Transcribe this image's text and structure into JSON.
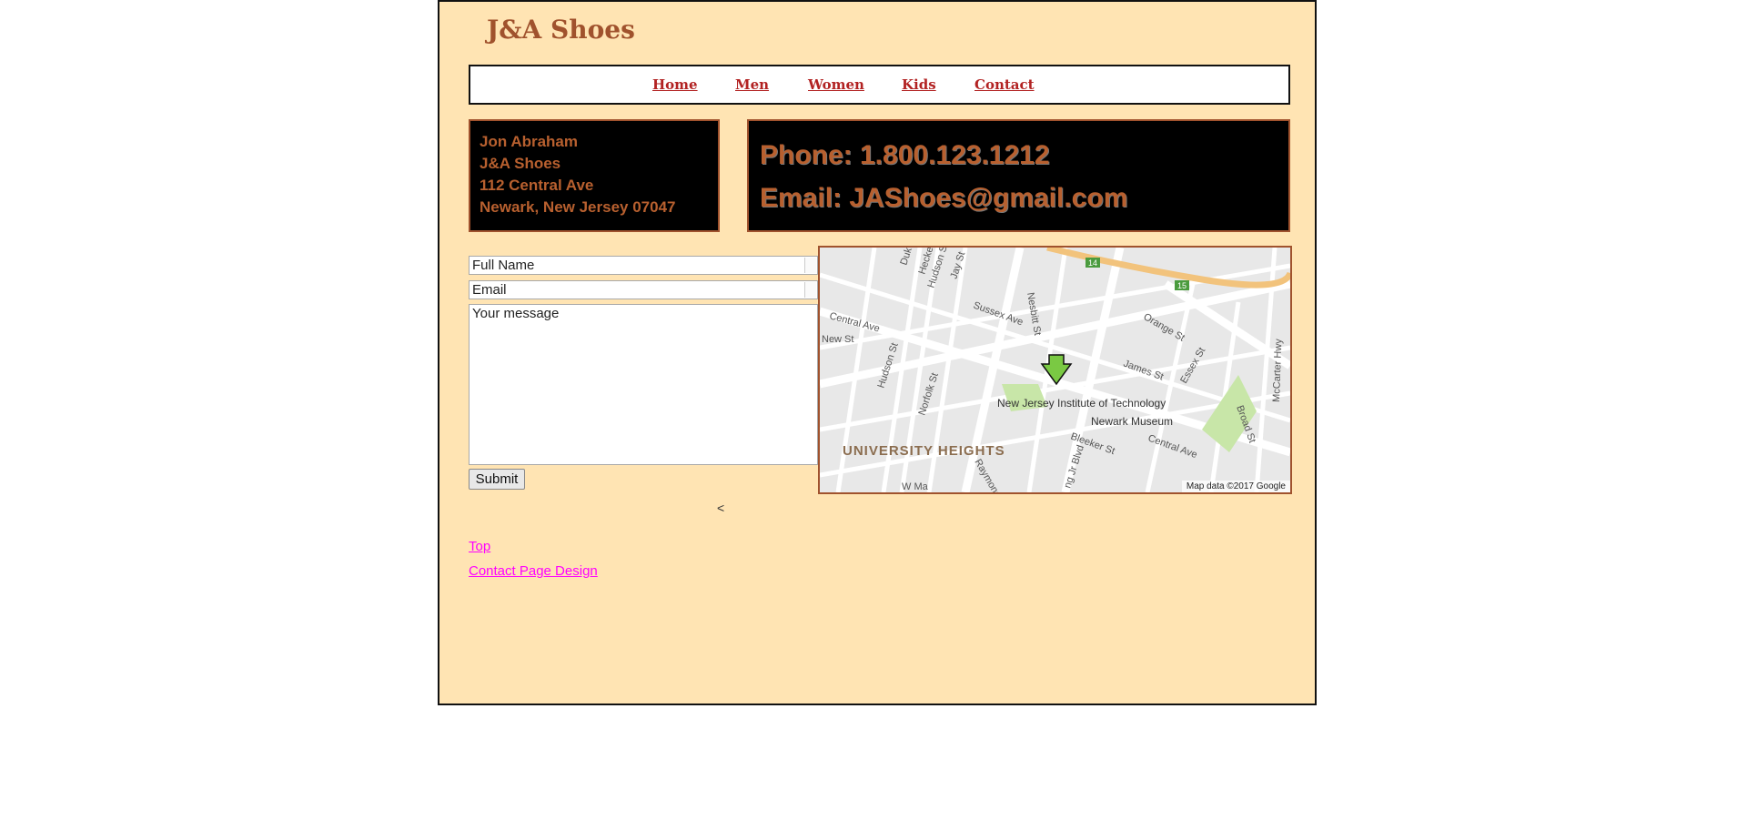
{
  "site": {
    "title": "J&A Shoes"
  },
  "nav": {
    "items": [
      "Home",
      "Men",
      "Women",
      "Kids",
      "Contact"
    ]
  },
  "address": {
    "name": "Jon Abraham",
    "company": "J&A Shoes",
    "street": "112 Central Ave",
    "city": "Newark, New Jersey 07047"
  },
  "contact": {
    "phone": "Phone: 1.800.123.1212",
    "email": "Email: JAShoes@gmail.com"
  },
  "form": {
    "name_placeholder": "Full Name",
    "email_placeholder": "Email",
    "message_placeholder": "Your message",
    "submit_label": "Submit"
  },
  "map": {
    "credit": "Map data ©2017 Google",
    "area_label": "UNIVERSITY HEIGHTS",
    "poi": [
      "New Jersey Institute of Technology",
      "Newark Museum"
    ],
    "streets": [
      "Central Ave",
      "New St",
      "Hudson St",
      "Norfolk St",
      "Sussex Ave",
      "Nesbitt St",
      "Orange St",
      "James St",
      "Essex St",
      "Broad St",
      "McCarter Hwy",
      "Bleeker St",
      "Central Ave",
      "Raymond",
      "W Ma",
      "Jay St",
      "Hecker",
      "Hudson St",
      "Duk",
      "ng Jr Blvd"
    ],
    "route_shields": [
      "14",
      "15"
    ]
  },
  "misc": {
    "stray_char": "<"
  },
  "footer": {
    "top_link": "Top",
    "design_link": "Contact Page Design"
  },
  "colors": {
    "page_bg": "#ffe4b3",
    "brand": "#a0522d",
    "nav_link": "#b22222",
    "footer_link": "#ff00ff"
  }
}
